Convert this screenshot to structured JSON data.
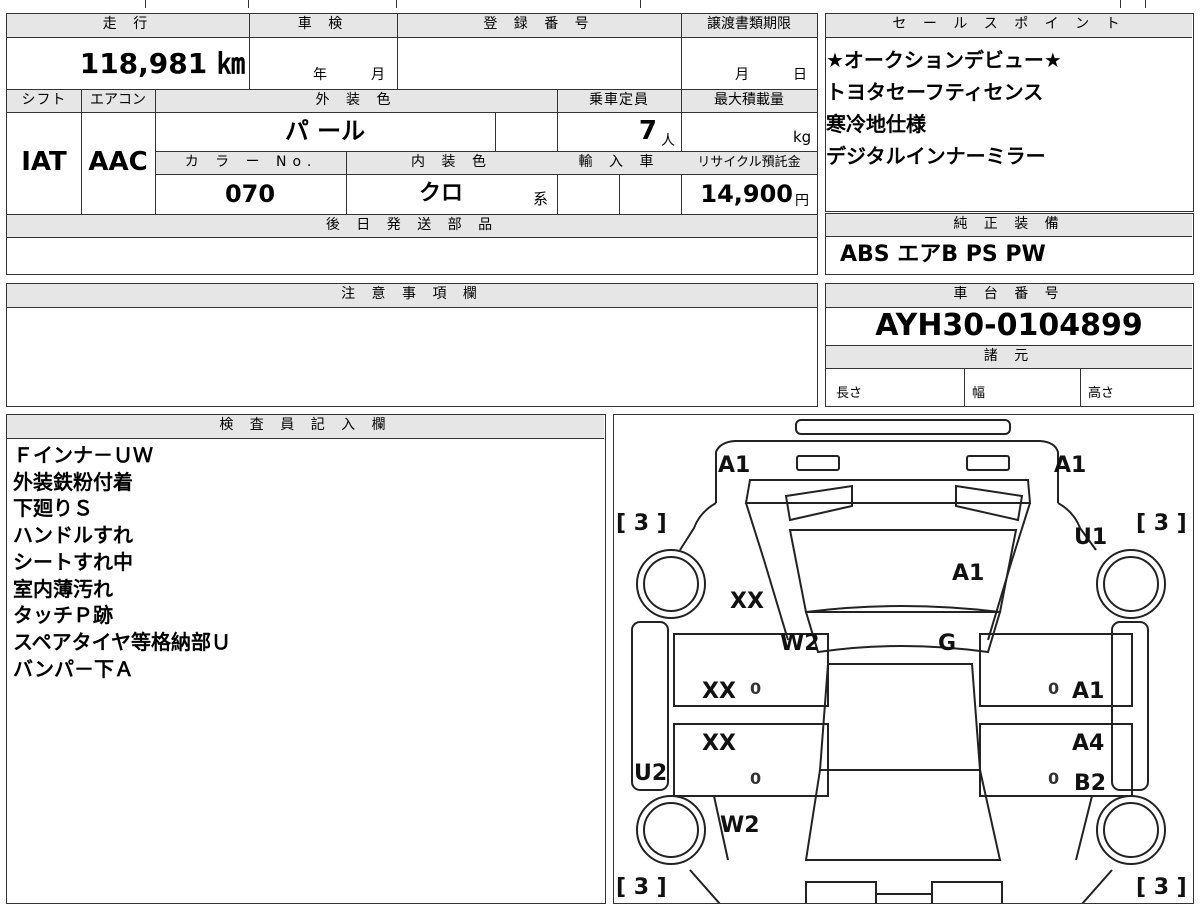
{
  "vehicle": {
    "mileage_header": "走 行",
    "mileage_value": "118,981 ㎞",
    "shaken_header": "車 検",
    "shaken_year": "年",
    "shaken_month": "月",
    "registration_header": "登 録 番 号",
    "transfer_deadline_header": "譲渡書類期限",
    "transfer_month": "月",
    "transfer_day": "日",
    "shift_header": "シフト",
    "shift_value": "IAT",
    "aircon_header": "エアコン",
    "aircon_value": "AAC",
    "exterior_color_header": "外 装 色",
    "exterior_color_value": "パ ール",
    "capacity_header": "乗車定員",
    "capacity_value": "7",
    "capacity_unit": "人",
    "max_load_header": "最大積載量",
    "max_load_unit": "kg",
    "color_no_header": "カ ラ ー No.",
    "color_no_value": "070",
    "interior_color_header": "内 装 色",
    "interior_color_value": "クロ",
    "interior_color_suffix": "系",
    "import_header": "輸 入 車",
    "recycle_header": "リサイクル預託金",
    "recycle_value": "14,900",
    "recycle_unit": "円",
    "later_parts_header": "後 日 発 送 部 品"
  },
  "sales_points": {
    "header": "セ ー ル ス ポ イ ン ト",
    "items": [
      "★オークションデビュー★",
      "トヨタセーフティセンス",
      "寒冷地仕様",
      "デジタルインナーミラー"
    ]
  },
  "equipment": {
    "header": "純 正 装 備",
    "value": "ABS エアB PS PW"
  },
  "notes": {
    "header": "注 意 事 項 欄"
  },
  "chassis": {
    "header": "車 台 番 号",
    "value": "AYH30-0104899",
    "specs_header": "諸 元",
    "length_label": "長さ",
    "width_label": "幅",
    "height_label": "高さ"
  },
  "inspector": {
    "header": "検 査 員 記 入 欄",
    "lines": [
      "Ｆインナ－ＵＷ",
      "外装鉄粉付着",
      "下廻りＳ",
      "ハンドルすれ",
      "シートすれ中",
      "室内薄汚れ",
      "タッチＰ跡",
      "スペアタイヤ等格納部Ｕ",
      "バンパ－下Ａ"
    ]
  },
  "diagram": {
    "marks": {
      "front_left": "A1",
      "front_right": "A1",
      "hood": "A1",
      "right_front_fender": "U1",
      "left_front_fender": "XX",
      "windshield_left": "W2",
      "windshield": "G",
      "left_front_door": "XX",
      "right_front_door": "A1",
      "left_rear_door": "XX",
      "right_rear_door_upper": "A4",
      "right_rear_door_lower": "B2",
      "left_rocker": "U2",
      "rear_left": "W2",
      "zero": "0"
    },
    "tire_tl": "[ 3 ]",
    "tire_tr": "[ 3 ]",
    "tire_bl": "[ 3 ]",
    "tire_br": "[ 3 ]"
  }
}
